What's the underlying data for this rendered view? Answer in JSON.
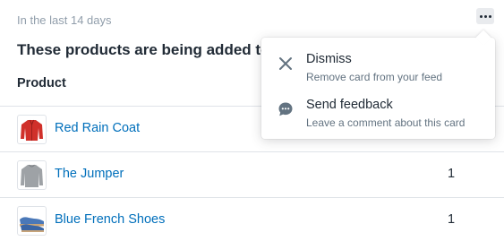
{
  "card": {
    "subtitle": "In the last 14 days",
    "heading": "These products are being added to",
    "column_product": "Product",
    "more_icon": "horizontal-dots-icon"
  },
  "products": [
    {
      "name": "Red Rain Coat",
      "qty": "",
      "thumb_icon": "red-coat-thumbnail",
      "color": "#d0302a"
    },
    {
      "name": "The Jumper",
      "qty": "1",
      "thumb_icon": "grey-jumper-thumbnail",
      "color": "#9ea2a6"
    },
    {
      "name": "Blue French Shoes",
      "qty": "1",
      "thumb_icon": "blue-shoes-thumbnail",
      "color": "#4a78b8"
    }
  ],
  "menu": {
    "items": [
      {
        "title": "Dismiss",
        "desc": "Remove card from your feed",
        "icon": "close-icon"
      },
      {
        "title": "Send feedback",
        "desc": "Leave a comment about this card",
        "icon": "chat-bubble-icon"
      }
    ]
  },
  "colors": {
    "link": "#006fbb",
    "text": "#212b36",
    "muted": "#919eab",
    "icon": "#637381"
  }
}
